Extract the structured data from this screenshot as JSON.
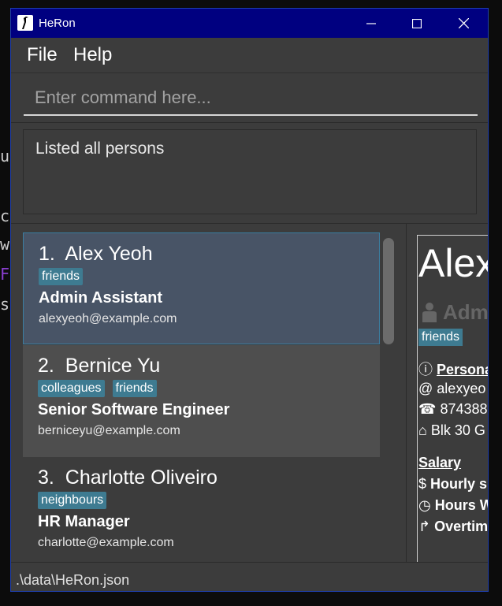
{
  "terminal": {
    "glyphs": [
      "u",
      "c",
      "w",
      "F",
      "s"
    ]
  },
  "window": {
    "title": "HeRon"
  },
  "menu": {
    "file": "File",
    "help": "Help"
  },
  "command": {
    "placeholder": "Enter command here..."
  },
  "result": {
    "message": "Listed all persons"
  },
  "persons": [
    {
      "index": "1.",
      "name": "Alex Yeoh",
      "tags": [
        "friends"
      ],
      "role": "Admin Assistant",
      "email": "alexyeoh@example.com"
    },
    {
      "index": "2.",
      "name": "Bernice Yu",
      "tags": [
        "colleagues",
        "friends"
      ],
      "role": "Senior Software Engineer",
      "email": "berniceyu@example.com"
    },
    {
      "index": "3.",
      "name": "Charlotte Oliveiro",
      "tags": [
        "neighbours"
      ],
      "role": "HR Manager",
      "email": "charlotte@example.com"
    }
  ],
  "detail": {
    "name": "Alex",
    "role": "Adm",
    "tag": "friends",
    "personal_heading": "Persona",
    "email": "alexyeo",
    "phone": "874388",
    "address": "Blk 30 G",
    "salary_heading": "Salary",
    "hourly": "Hourly s",
    "hours": "Hours W",
    "overtime": "Overtim"
  },
  "status": {
    "path": ".\\data\\HeRon.json"
  },
  "colors": {
    "titlebar": "#000080",
    "tag": "#3e7b91",
    "selected": "#485466"
  }
}
